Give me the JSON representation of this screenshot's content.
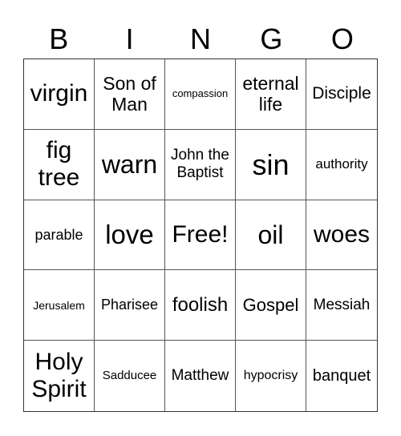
{
  "header": {
    "letters": [
      "B",
      "I",
      "N",
      "G",
      "O"
    ]
  },
  "cells": [
    {
      "text": "virgin",
      "size": 30
    },
    {
      "text": "Son of Man",
      "size": 23
    },
    {
      "text": "compassion",
      "size": 13
    },
    {
      "text": "eternal life",
      "size": 23
    },
    {
      "text": "Disciple",
      "size": 21
    },
    {
      "text": "fig tree",
      "size": 30
    },
    {
      "text": "warn",
      "size": 32
    },
    {
      "text": "John the Baptist",
      "size": 19
    },
    {
      "text": "sin",
      "size": 36
    },
    {
      "text": "authority",
      "size": 17
    },
    {
      "text": "parable",
      "size": 18
    },
    {
      "text": "love",
      "size": 33
    },
    {
      "text": "Free!",
      "size": 30
    },
    {
      "text": "oil",
      "size": 32
    },
    {
      "text": "woes",
      "size": 30
    },
    {
      "text": "Jerusalem",
      "size": 14
    },
    {
      "text": "Pharisee",
      "size": 18
    },
    {
      "text": "foolish",
      "size": 24
    },
    {
      "text": "Gospel",
      "size": 22
    },
    {
      "text": "Messiah",
      "size": 19
    },
    {
      "text": "Holy Spirit",
      "size": 30
    },
    {
      "text": "Sadducee",
      "size": 15
    },
    {
      "text": "Matthew",
      "size": 19
    },
    {
      "text": "hypocrisy",
      "size": 16
    },
    {
      "text": "banquet",
      "size": 20
    }
  ]
}
